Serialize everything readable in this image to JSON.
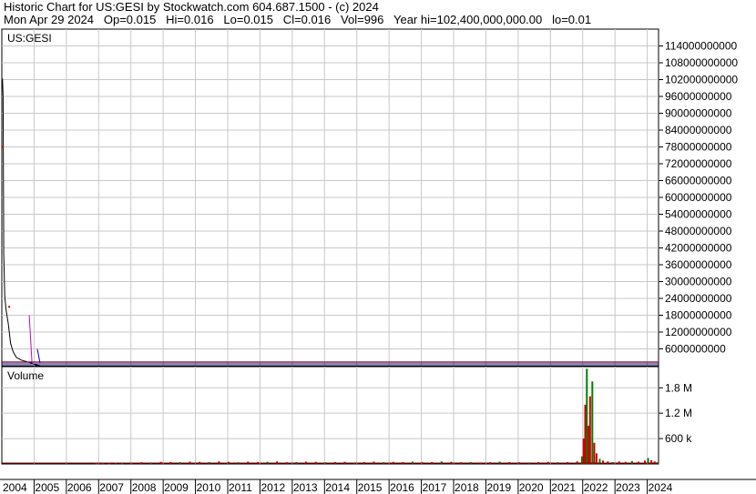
{
  "header": {
    "line1": "Historic Chart for US:GESI by Stockwatch.com 604.687.1500 - (c) 2024",
    "line2": "Mon Apr 29 2024   Op=0.015   Hi=0.016   Lo=0.015   Cl=0.016   Vol=996   Year hi=102,400,000,000.00   lo=0.01"
  },
  "chart_data": [
    {
      "type": "line",
      "title": "US:GESI",
      "x_years": [
        "2004",
        "2005",
        "2006",
        "2007",
        "2008",
        "2009",
        "2010",
        "2011",
        "2012",
        "2013",
        "2014",
        "2015",
        "2016",
        "2017",
        "2018",
        "2019",
        "2020",
        "2021",
        "2022",
        "2023",
        "2024"
      ],
      "xlim": [
        2004.0,
        2024.35
      ],
      "y_tick_labels": [
        "114000000000",
        "108000000000",
        "102000000000",
        "96000000000",
        "90000000000",
        "84000000000",
        "78000000000",
        "72000000000",
        "66000000000",
        "60000000000",
        "54000000000",
        "48000000000",
        "42000000000",
        "36000000000",
        "30000000000",
        "24000000000",
        "18000000000",
        "12000000000",
        "6000000000"
      ],
      "ylim": [
        0,
        120000000000
      ],
      "grid": true,
      "colors": {
        "price": "#000000",
        "up": "#cc0000",
        "spike": "#cc00cc",
        "ma": "#0000cc",
        "baseline": "#800000"
      },
      "series": [
        {
          "values": [
            [
              2004.02,
              102400000000
            ],
            [
              2004.04,
              96000000000
            ],
            [
              2004.06,
              40000000000
            ],
            [
              2004.09,
              25000000000
            ],
            [
              2004.13,
              20000000000
            ],
            [
              2004.2,
              15000000000
            ],
            [
              2004.27,
              8000000000
            ],
            [
              2004.35,
              5000000000
            ],
            [
              2004.45,
              3000000000
            ],
            [
              2004.6,
              2000000000
            ],
            [
              2004.9,
              1000000000
            ],
            [
              2005.0,
              500000000
            ],
            [
              2005.2,
              10000000
            ],
            [
              2010.0,
              0.01
            ],
            [
              2024.32,
              0.016
            ]
          ]
        }
      ],
      "markers": [
        {
          "x": 2004.0,
          "y": 78000000000,
          "color": "#cc0000"
        },
        {
          "x": 2004.2,
          "y": 21000000000,
          "color": "#cc0000"
        }
      ],
      "spike_bars": [
        {
          "x": 2004.85,
          "y": 18000000000,
          "color": "#cc00cc"
        },
        {
          "x": 2005.1,
          "y": 6000000000,
          "color": "#0000cc"
        }
      ]
    },
    {
      "type": "bar",
      "title": "Volume",
      "y_tick_labels": [
        "1.8 M",
        "1.2 M",
        "600 k"
      ],
      "ylim": [
        0,
        2300000
      ],
      "grid": true,
      "values": [
        [
          2006.9,
          15000
        ],
        [
          2007.1,
          20000
        ],
        [
          2007.3,
          10000
        ],
        [
          2007.5,
          25000
        ],
        [
          2007.7,
          18000
        ],
        [
          2008.0,
          30000
        ],
        [
          2008.3,
          40000
        ],
        [
          2008.6,
          35000
        ],
        [
          2008.9,
          50000
        ],
        [
          2009.2,
          45000
        ],
        [
          2009.5,
          40000
        ],
        [
          2009.8,
          55000
        ],
        [
          2010.1,
          50000
        ],
        [
          2010.4,
          45000
        ],
        [
          2010.7,
          60000
        ],
        [
          2011.0,
          50000
        ],
        [
          2011.3,
          40000
        ],
        [
          2011.6,
          55000
        ],
        [
          2011.9,
          45000
        ],
        [
          2012.2,
          50000
        ],
        [
          2012.5,
          60000
        ],
        [
          2012.8,
          40000
        ],
        [
          2013.1,
          45000
        ],
        [
          2013.4,
          55000
        ],
        [
          2013.7,
          50000
        ],
        [
          2014.0,
          40000
        ],
        [
          2014.3,
          45000
        ],
        [
          2014.6,
          50000
        ],
        [
          2014.9,
          35000
        ],
        [
          2015.2,
          45000
        ],
        [
          2015.5,
          55000
        ],
        [
          2015.8,
          40000
        ],
        [
          2016.1,
          50000
        ],
        [
          2016.4,
          45000
        ],
        [
          2016.7,
          55000
        ],
        [
          2017.0,
          40000
        ],
        [
          2017.3,
          45000
        ],
        [
          2017.6,
          60000
        ],
        [
          2017.9,
          50000
        ],
        [
          2018.2,
          40000
        ],
        [
          2018.5,
          45000
        ],
        [
          2018.8,
          35000
        ],
        [
          2019.1,
          40000
        ],
        [
          2019.4,
          55000
        ],
        [
          2019.7,
          45000
        ],
        [
          2020.0,
          40000
        ],
        [
          2020.3,
          35000
        ],
        [
          2020.6,
          45000
        ],
        [
          2020.9,
          50000
        ],
        [
          2021.2,
          40000
        ],
        [
          2021.5,
          45000
        ],
        [
          2021.8,
          60000
        ],
        [
          2021.95,
          180000
        ],
        [
          2022.0,
          600000
        ],
        [
          2022.05,
          1400000
        ],
        [
          2022.1,
          2250000
        ],
        [
          2022.15,
          900000
        ],
        [
          2022.2,
          1600000
        ],
        [
          2022.27,
          1950000
        ],
        [
          2022.33,
          500000
        ],
        [
          2022.4,
          250000
        ],
        [
          2022.5,
          120000
        ],
        [
          2022.6,
          80000
        ],
        [
          2022.75,
          60000
        ],
        [
          2022.9,
          45000
        ],
        [
          2023.1,
          60000
        ],
        [
          2023.3,
          50000
        ],
        [
          2023.5,
          70000
        ],
        [
          2023.7,
          55000
        ],
        [
          2023.9,
          80000
        ],
        [
          2024.0,
          140000
        ],
        [
          2024.1,
          90000
        ],
        [
          2024.2,
          60000
        ],
        [
          2024.3,
          40000
        ]
      ]
    }
  ]
}
